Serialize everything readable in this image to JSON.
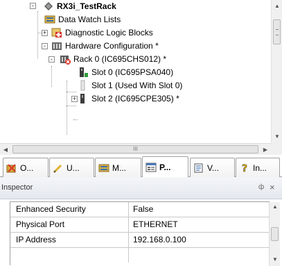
{
  "tree": {
    "items": [
      {
        "label": "RX3i_TestRack",
        "icon": "rack-diamond-icon",
        "expander": "-"
      },
      {
        "label": "Data Watch Lists",
        "icon": "data-watch-icon",
        "expander": ""
      },
      {
        "label": "Diagnostic Logic Blocks",
        "icon": "diagnostic-block-icon",
        "expander": "+"
      },
      {
        "label": "Hardware Configuration *",
        "icon": "hardware-config-icon",
        "expander": "-"
      },
      {
        "label": "Rack 0 (IC695CHS012) *",
        "icon": "rack-icon",
        "expander": "-"
      },
      {
        "label": "Slot 0 (IC695PSA040)",
        "icon": "power-supply-icon",
        "expander": ""
      },
      {
        "label": "Slot 1 (Used With Slot 0)",
        "icon": "empty-slot-icon",
        "expander": ""
      },
      {
        "label": "Slot 2 (IC695CPE305) *",
        "icon": "cpu-module-icon",
        "expander": "+"
      }
    ],
    "hscroll_grip": "III"
  },
  "tabs": [
    {
      "label": "O...",
      "icon": "navigator-icon"
    },
    {
      "label": "U...",
      "icon": "pencil-icon"
    },
    {
      "label": "M...",
      "icon": "monitor-icon"
    },
    {
      "label": "P...",
      "icon": "properties-icon",
      "active": true
    },
    {
      "label": "V...",
      "icon": "variables-icon"
    },
    {
      "label": "In...",
      "icon": "help-icon"
    }
  ],
  "inspector": {
    "title": "Inspector",
    "pin": "ф",
    "close": "×",
    "rows": [
      {
        "key": "Enhanced Security",
        "value": "False"
      },
      {
        "key": "Physical Port",
        "value": "ETHERNET"
      },
      {
        "key": "IP Address",
        "value": "192.168.0.100"
      }
    ]
  }
}
